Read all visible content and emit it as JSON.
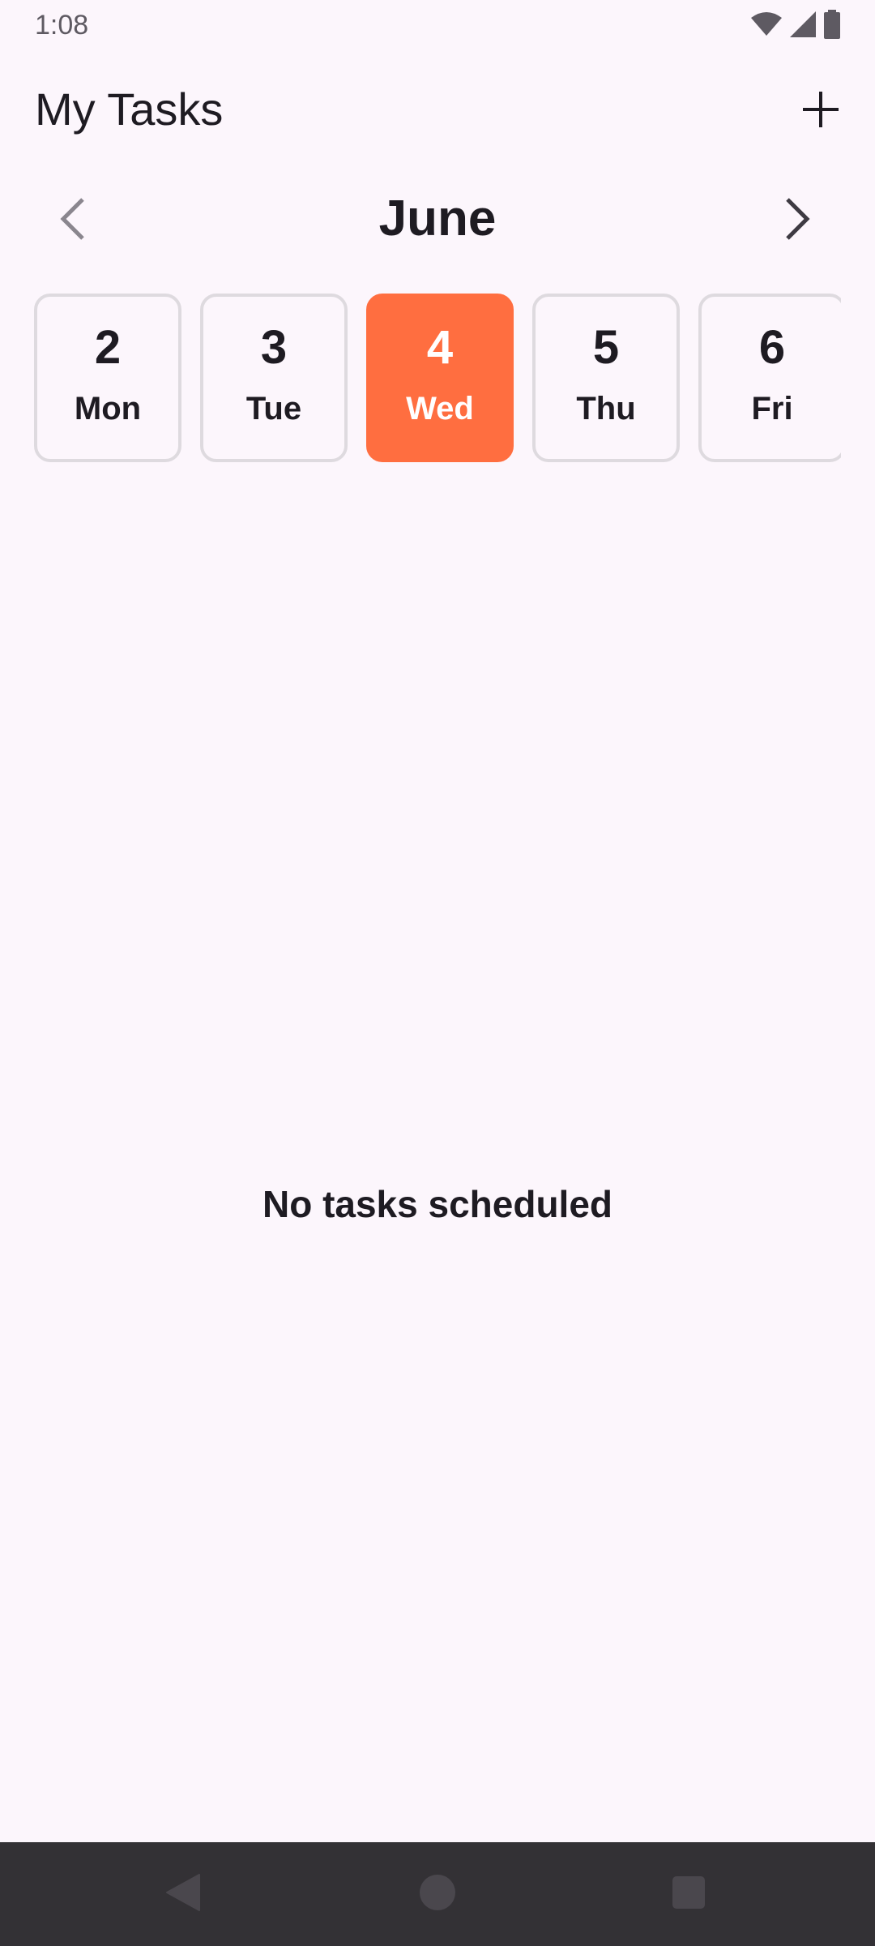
{
  "status_bar": {
    "time": "1:08",
    "icons": [
      "wifi-icon",
      "signal-icon",
      "battery-icon"
    ]
  },
  "header": {
    "title": "My Tasks",
    "add_icon": "plus-icon"
  },
  "month_nav": {
    "month": "June",
    "prev_icon": "chevron-left-icon",
    "next_icon": "chevron-right-icon"
  },
  "days": [
    {
      "num": "2",
      "name": "Mon",
      "selected": false
    },
    {
      "num": "3",
      "name": "Tue",
      "selected": false
    },
    {
      "num": "4",
      "name": "Wed",
      "selected": true
    },
    {
      "num": "5",
      "name": "Thu",
      "selected": false
    },
    {
      "num": "6",
      "name": "Fri",
      "selected": false
    }
  ],
  "empty_state": {
    "message": "No tasks scheduled"
  },
  "nav_bar": {
    "buttons": [
      "back-icon",
      "home-icon",
      "recents-icon"
    ]
  },
  "colors": {
    "background": "#FCF6FC",
    "accent": "#FF6E40",
    "text": "#1E1B22",
    "card_border": "#DEDADF",
    "nav_bar": "#333135"
  }
}
